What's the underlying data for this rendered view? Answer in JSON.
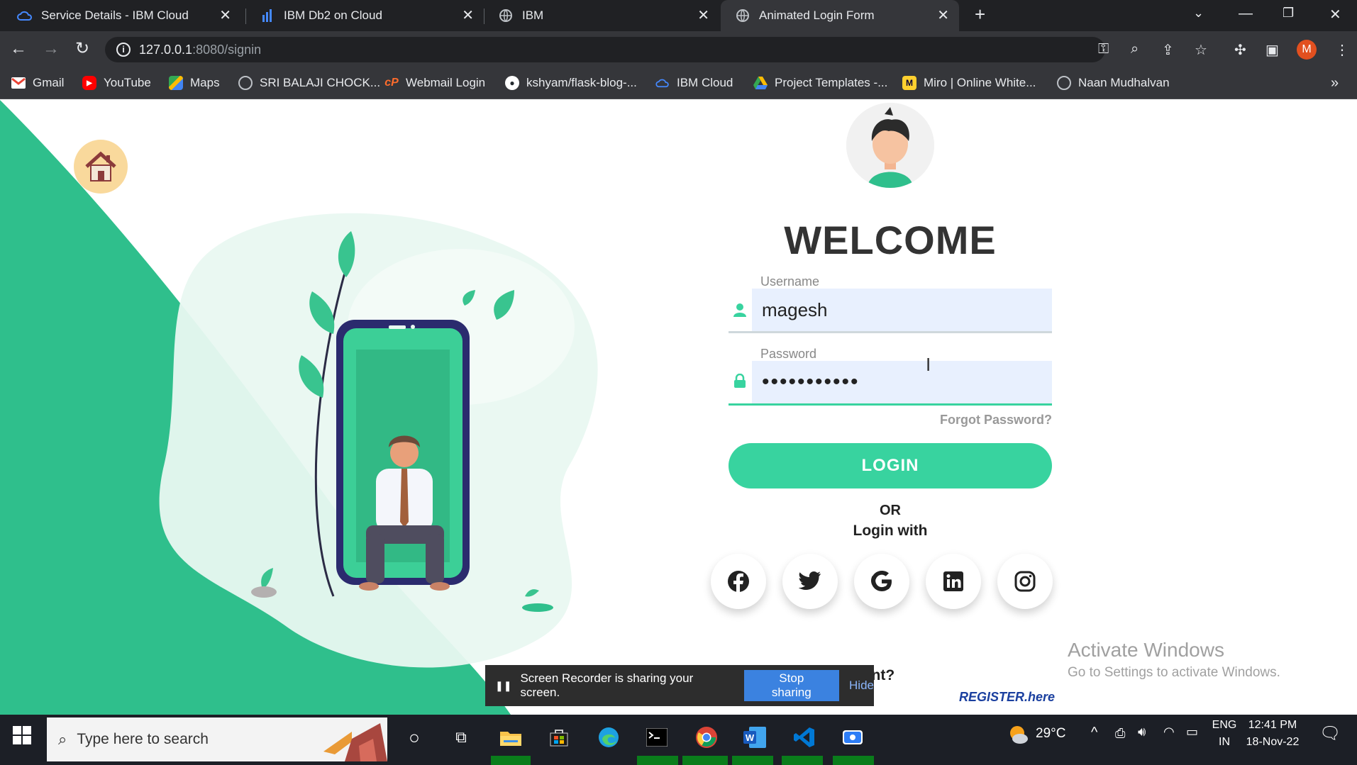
{
  "browser": {
    "tabs": [
      {
        "title": "Service Details - IBM Cloud",
        "icon": "ibm-cloud-icon"
      },
      {
        "title": "IBM Db2 on Cloud",
        "icon": "db2-icon"
      },
      {
        "title": "IBM",
        "icon": "globe-icon"
      },
      {
        "title": "Animated Login Form",
        "icon": "globe-icon",
        "active": true
      }
    ],
    "url": {
      "host": "127.0.0.1",
      "path": ":8080/signin"
    },
    "profile_initial": "M",
    "bookmarks": [
      {
        "label": "Gmail",
        "icon": "gmail-icon"
      },
      {
        "label": "YouTube",
        "icon": "youtube-icon"
      },
      {
        "label": "Maps",
        "icon": "maps-icon"
      },
      {
        "label": "SRI BALAJI CHOCK...",
        "icon": "globe-icon"
      },
      {
        "label": "Webmail Login",
        "icon": "cpanel-icon"
      },
      {
        "label": "kshyam/flask-blog-...",
        "icon": "github-icon"
      },
      {
        "label": "IBM Cloud",
        "icon": "ibm-cloud-icon"
      },
      {
        "label": "Project Templates -...",
        "icon": "google-drive-icon"
      },
      {
        "label": "Miro | Online White...",
        "icon": "miro-icon"
      },
      {
        "label": "Naan Mudhalvan",
        "icon": "globe-icon"
      }
    ]
  },
  "login": {
    "welcome": "WELCOME",
    "username_label": "Username",
    "username_value": "magesh",
    "password_label": "Password",
    "password_value": "•••••••••••",
    "forgot": "Forgot Password?",
    "login_button": "LOGIN",
    "or": "OR",
    "login_with": "Login with",
    "social": [
      "facebook",
      "twitter",
      "google",
      "linkedin",
      "instagram"
    ],
    "no_account": "e an account?",
    "register": "REGISTER.here"
  },
  "overlay": {
    "activate_title": "Activate Windows",
    "activate_sub": "Go to Settings to activate Windows.",
    "share_text": "Screen Recorder is sharing your screen.",
    "stop_sharing": "Stop sharing",
    "hide": "Hide"
  },
  "taskbar": {
    "search_placeholder": "Type here to search",
    "weather": "29°C",
    "lang_top": "ENG",
    "lang_bottom": "IN",
    "time": "12:41 PM",
    "date": "18-Nov-22"
  },
  "colors": {
    "accent": "#38d39f",
    "field_bg": "#e8f0fe",
    "wave": "#2fbf8c"
  }
}
